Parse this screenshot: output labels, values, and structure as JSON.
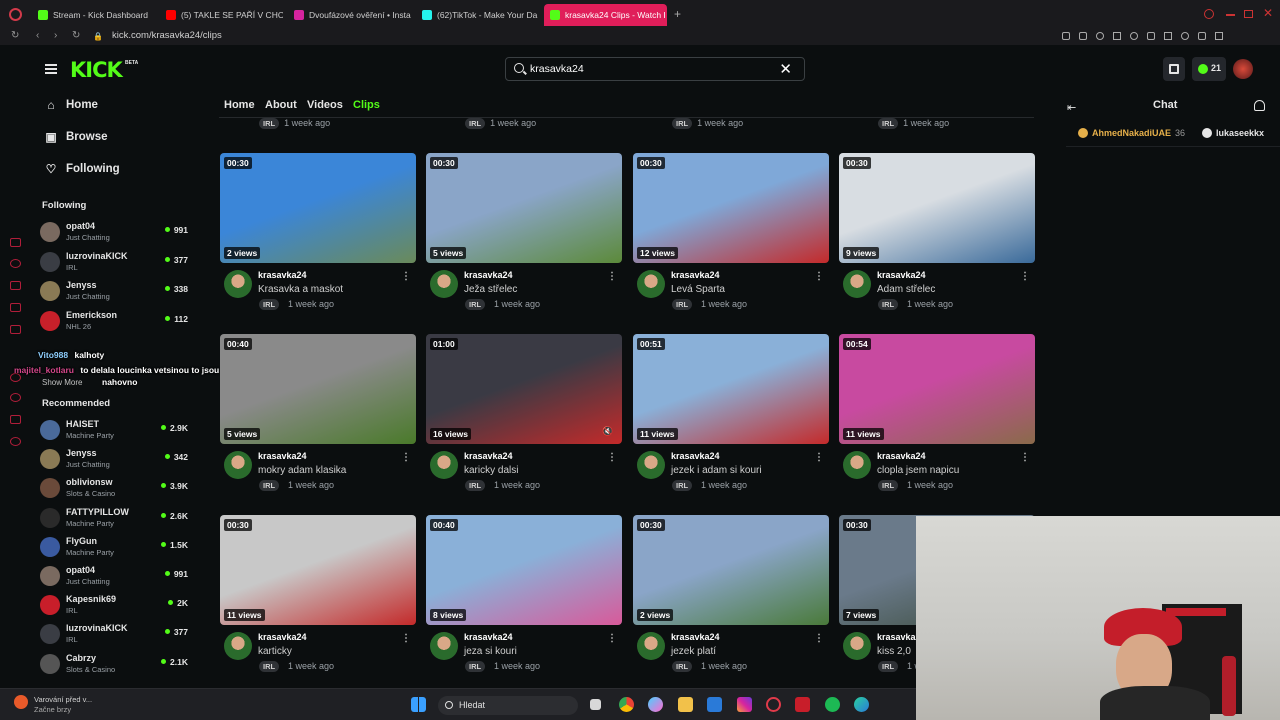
{
  "browser": {
    "tabs": [
      {
        "label": "Stream - Kick Dashboard",
        "color": "#53fc18"
      },
      {
        "label": "(5) TAKLE SE PAŘÍ V CHOR",
        "color": "#ff0000"
      },
      {
        "label": "Dvoufázové ověření • Insta",
        "color": "#d6249f"
      },
      {
        "label": "(62)TikTok - Make Your Da",
        "color": "#25f4ee"
      },
      {
        "label": "krasavka24 Clips - Watch I",
        "color": "#53fc18"
      }
    ],
    "url": "kick.com/krasavka24/clips"
  },
  "header": {
    "logo": "KICK",
    "beta": "BETA",
    "search_value": "krasavka24",
    "notification_count": "21"
  },
  "sidebar": {
    "nav": [
      {
        "label": "Home",
        "icon": "home-icon"
      },
      {
        "label": "Browse",
        "icon": "browse-icon"
      },
      {
        "label": "Following",
        "icon": "heart-icon"
      }
    ],
    "following_title": "Following",
    "following": [
      {
        "name": "opat04",
        "category": "Just Chatting",
        "count": "991",
        "avatar": "#7a6a60"
      },
      {
        "name": "luzrovinaKICK",
        "category": "IRL",
        "count": "377",
        "avatar": "#3a3d44"
      },
      {
        "name": "Jenyss",
        "category": "Just Chatting",
        "count": "338",
        "avatar": "#8a7a55"
      },
      {
        "name": "Emerickson",
        "category": "NHL 26",
        "count": "112",
        "avatar": "#c8202a"
      }
    ],
    "show_more": "Show More",
    "recommended_title": "Recommended",
    "recommended": [
      {
        "name": "HAISET",
        "category": "Machine Party",
        "count": "2.9K",
        "avatar": "#4a6a9a"
      },
      {
        "name": "Jenyss",
        "category": "Just Chatting",
        "count": "342",
        "avatar": "#8a7a55"
      },
      {
        "name": "oblivionsw",
        "category": "Slots & Casino",
        "count": "3.9K",
        "avatar": "#6a4a3a"
      },
      {
        "name": "FATTYPILLOW",
        "category": "Machine Party",
        "count": "2.6K",
        "avatar": "#2a2a2a"
      },
      {
        "name": "FlyGun",
        "category": "Machine Party",
        "count": "1.5K",
        "avatar": "#3a5aa0"
      },
      {
        "name": "opat04",
        "category": "Just Chatting",
        "count": "991",
        "avatar": "#7a6a60"
      },
      {
        "name": "Kapesnik69",
        "category": "IRL",
        "count": "2K",
        "avatar": "#c81e2a"
      },
      {
        "name": "luzrovinaKICK",
        "category": "IRL",
        "count": "377",
        "avatar": "#3a3d44"
      },
      {
        "name": "Cabrzy",
        "category": "Slots & Casino",
        "count": "2.1K",
        "avatar": "#555"
      }
    ]
  },
  "overlay_chat": [
    {
      "user": "Vito988",
      "text": "kalhoty"
    },
    {
      "user": "majitel_kotlaru",
      "text": "to delala loucinka vetsinou to jsou vpici klipy upine"
    },
    {
      "user": "",
      "text": "nahovno"
    }
  ],
  "channel_tabs": [
    "Home",
    "About",
    "Videos",
    "Clips"
  ],
  "clips_meta": {
    "tag": "IRL",
    "ago": "1 week ago",
    "channel": "krasavka24"
  },
  "clips": [
    {
      "duration": "00:30",
      "views": "2 views",
      "title": "Krasavka a maskot",
      "c1": "#3b86d8",
      "c2": "#6a8a5a"
    },
    {
      "duration": "00:30",
      "views": "5 views",
      "title": "Ježa střelec",
      "c1": "#8aa5c8",
      "c2": "#5c8a3a"
    },
    {
      "duration": "00:30",
      "views": "12 views",
      "title": "Levá Sparta",
      "c1": "#7fa8d8",
      "c2": "#c42a2a"
    },
    {
      "duration": "00:30",
      "views": "9 views",
      "title": "Adam střelec",
      "c1": "#d8dde2",
      "c2": "#3a6a9a"
    },
    {
      "duration": "00:40",
      "views": "5 views",
      "title": "mokry adam klasika",
      "c1": "#8a8a8a",
      "c2": "#4a7a2a"
    },
    {
      "duration": "01:00",
      "views": "16 views",
      "title": "karicky dalsi",
      "c1": "#3a3a44",
      "c2": "#c42a2a"
    },
    {
      "duration": "00:51",
      "views": "11 views",
      "title": "jezek i adam si kouri",
      "c1": "#8ab0d8",
      "c2": "#c42a2a"
    },
    {
      "duration": "00:54",
      "views": "11 views",
      "title": "clopla jsem napicu",
      "c1": "#c84aa0",
      "c2": "#8a6a4a"
    },
    {
      "duration": "00:30",
      "views": "11 views",
      "title": "karticky",
      "c1": "#c8c8c8",
      "c2": "#c42a2a"
    },
    {
      "duration": "00:40",
      "views": "8 views",
      "title": "jeza si kouri",
      "c1": "#8ab0d8",
      "c2": "#d85a9a"
    },
    {
      "duration": "00:30",
      "views": "2 views",
      "title": "jezek platí",
      "c1": "#8aa5c8",
      "c2": "#4a7a3a"
    },
    {
      "duration": "00:30",
      "views": "7 views",
      "title": "kiss 2,0",
      "c1": "#6a7a8a",
      "c2": "#3a4a3a"
    }
  ],
  "chat": {
    "title": "Chat",
    "pinned": [
      {
        "user": "AhmedNakadiUAE",
        "count": "36",
        "color": "#e6b04a"
      },
      {
        "user": "lukaseekkx",
        "count": "",
        "color": "#e6e6e6"
      }
    ]
  },
  "taskbar": {
    "notice_title": "Varování před v...",
    "notice_sub": "Začne brzy",
    "search_placeholder": "Hledat"
  }
}
